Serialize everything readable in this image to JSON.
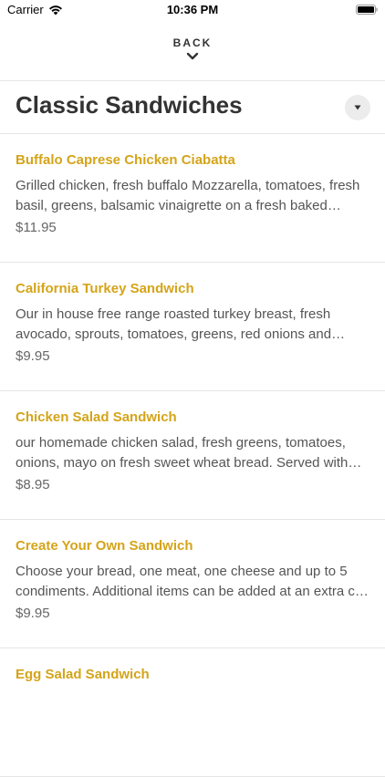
{
  "status_bar": {
    "carrier": "Carrier",
    "time": "10:36 PM"
  },
  "nav": {
    "back_label": "BACK"
  },
  "section": {
    "title": "Classic Sandwiches"
  },
  "colors": {
    "item_name": "#d4a419",
    "title": "#333333",
    "divider": "#e5e5e5"
  },
  "items": [
    {
      "name": "Buffalo Caprese Chicken Ciabatta",
      "description": "Grilled chicken, fresh buffalo Mozzarella, tomatoes, fresh basil, greens, balsamic vinaigrette on a fresh baked ciaba…",
      "price": "$11.95"
    },
    {
      "name": "California Turkey Sandwich",
      "description": "Our in house free range roasted turkey breast, fresh avocado, sprouts, tomatoes, greens, red onions and may…",
      "price": "$9.95"
    },
    {
      "name": "Chicken Salad Sandwich",
      "description": "our homemade chicken salad, fresh greens, tomatoes, onions, mayo on fresh sweet wheat bread. Served with y…",
      "price": "$8.95"
    },
    {
      "name": "Create Your Own Sandwich",
      "description": "Choose your bread, one meat, one cheese and up to 5 condiments. Additional items can be added at an extra c…",
      "price": "$9.95"
    },
    {
      "name": "Egg Salad Sandwich",
      "description": "",
      "price": ""
    }
  ]
}
